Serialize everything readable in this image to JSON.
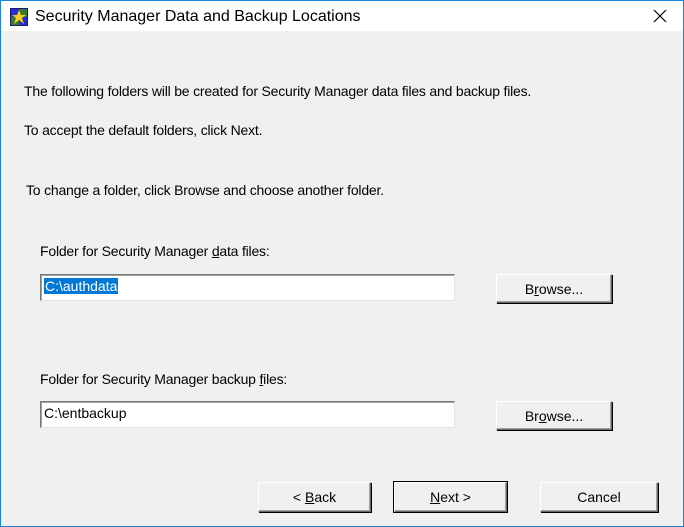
{
  "window": {
    "title": "Security Manager Data and Backup Locations",
    "icon": "security-manager-app-icon",
    "close_glyph": "✕"
  },
  "intro": {
    "line1": "The following folders will be created for Security Manager data files and backup files.",
    "line2": "To accept the default folders, click Next.",
    "line3": "To change a folder, click Browse and choose another folder."
  },
  "data_folder": {
    "label_before": "Folder for Security Manager ",
    "label_accel": "d",
    "label_after": "ata files:",
    "value": "C:\\authdata",
    "browse_before": "B",
    "browse_accel": "r",
    "browse_after": "owse..."
  },
  "backup_folder": {
    "label_before": "Folder for Security Manager backup ",
    "label_accel": "f",
    "label_after": "iles:",
    "value": "C:\\entbackup",
    "browse_before": "Br",
    "browse_accel": "o",
    "browse_after": "wse..."
  },
  "footer": {
    "back_prefix": "< ",
    "back_accel": "B",
    "back_rest": "ack",
    "next_accel": "N",
    "next_rest": "ext >",
    "cancel": "Cancel"
  },
  "colors": {
    "selection": "#0078d7",
    "border_accent": "#1883d7",
    "dialog_bg": "#f0f0f0"
  }
}
